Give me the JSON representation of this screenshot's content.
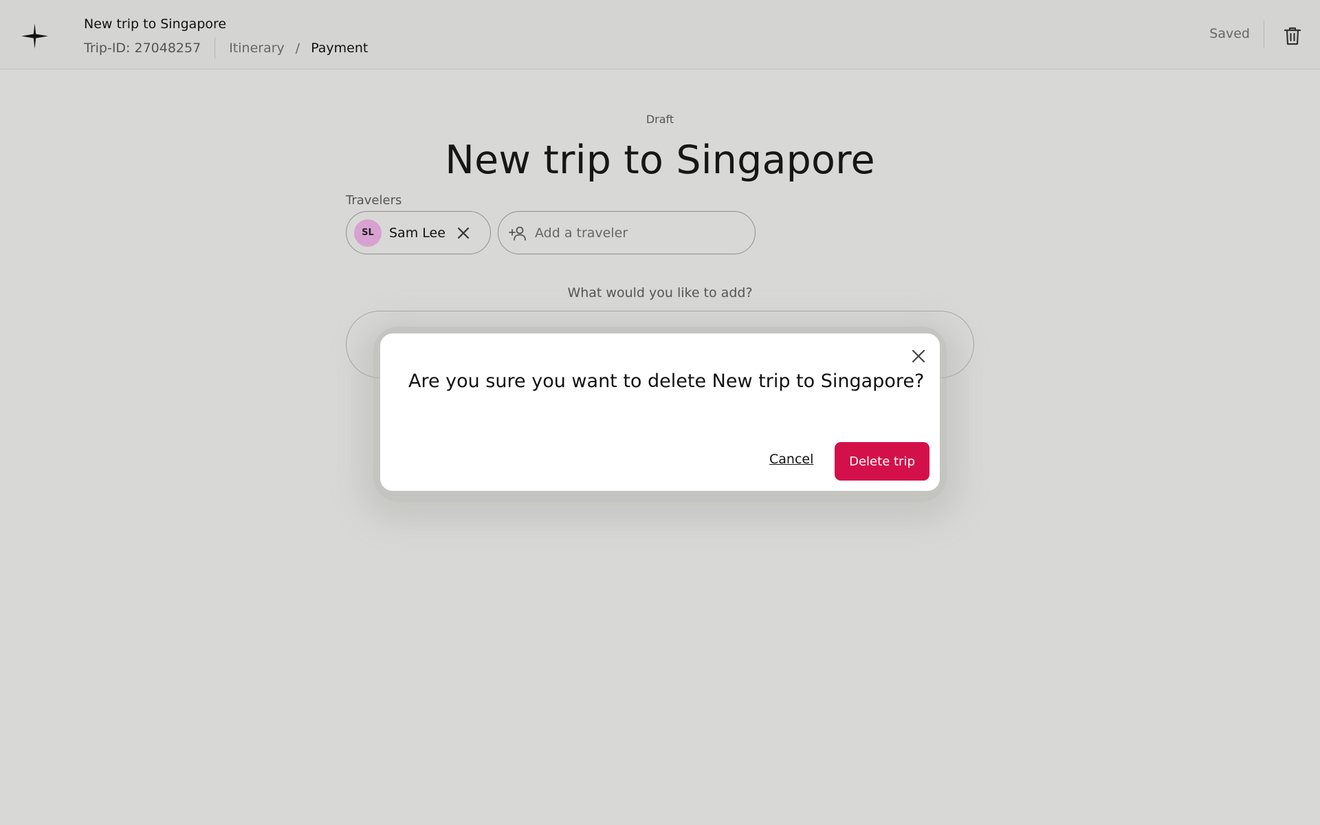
{
  "header": {
    "trip_name": "New trip to Singapore",
    "trip_id": "Trip-ID: 27048257",
    "breadcrumb": {
      "itinerary": "Itinerary",
      "separator": "/",
      "payment": "Payment"
    },
    "saved_label": "Saved"
  },
  "main": {
    "status": "Draft",
    "title": "New trip to Singapore",
    "travelers_label": "Travelers",
    "traveler": {
      "initials": "SL",
      "name": "Sam Lee",
      "avatar_color": "#d7a2cf"
    },
    "add_traveler_placeholder": "Add a traveler",
    "what_label": "What would you like to add?"
  },
  "modal": {
    "title": "Are you sure you want to delete New trip to Singapore?",
    "cancel_label": "Cancel",
    "delete_label": "Delete trip",
    "delete_color": "#d3104a"
  }
}
